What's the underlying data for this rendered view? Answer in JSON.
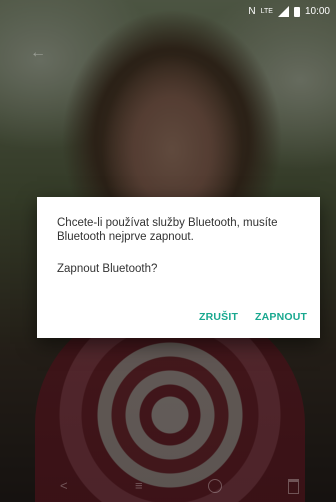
{
  "status_bar": {
    "carrier_text": "N",
    "network_text": "LTE",
    "time": "10:00"
  },
  "dialog": {
    "message": "Chcete-li používat služby Bluetooth, musíte Bluetooth nejprve zapnout.",
    "question": "Zapnout Bluetooth?",
    "cancel_label": "ZRUŠIT",
    "confirm_label": "ZAPNOUT"
  },
  "icons": {
    "back": "back-arrow-icon",
    "share": "share-icon",
    "edit": "tune-icon",
    "info": "info-icon",
    "delete": "trash-icon"
  },
  "colors": {
    "accent": "#18a88f",
    "dialog_bg": "#ffffff",
    "text": "#333333"
  }
}
